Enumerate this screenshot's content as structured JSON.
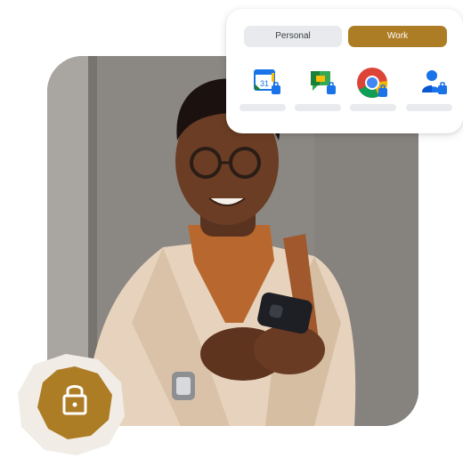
{
  "profile_tabs": {
    "personal_label": "Personal",
    "work_label": "Work",
    "active": "Work",
    "active_color": "#ad7d26"
  },
  "apps": [
    {
      "icon": "calendar-icon",
      "badge_text": "31"
    },
    {
      "icon": "chat-icon"
    },
    {
      "icon": "chrome-icon"
    },
    {
      "icon": "contacts-icon"
    }
  ],
  "badge": {
    "icon": "lock-icon",
    "color": "#ad7d26"
  },
  "photo": {
    "subject": "person-using-phone"
  }
}
